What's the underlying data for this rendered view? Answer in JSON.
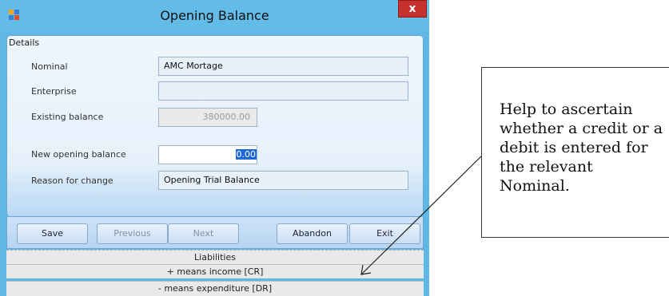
{
  "window": {
    "title": "Opening Balance",
    "close_label": "x"
  },
  "details": {
    "header": "Details",
    "fields": [
      {
        "label": "Nominal",
        "value": "AMC Mortage"
      },
      {
        "label": "Enterprise",
        "value": ""
      },
      {
        "label": "Existing balance",
        "value": "380000.00"
      },
      {
        "label": "New opening balance",
        "value": "0.00"
      },
      {
        "label": "Reason for change",
        "value": "Opening Trial Balance"
      }
    ]
  },
  "buttons": {
    "save": "Save",
    "previous": "Previous",
    "next": "Next",
    "abandon": "Abandon",
    "exit": "Exit"
  },
  "info": {
    "liabilities": "Liabilities",
    "income": "+ means income [CR]",
    "expenditure": "- means expenditure [DR]"
  },
  "callout": {
    "text": "Help to ascertain whether a credit or a debit is entered for the relevant Nominal."
  }
}
